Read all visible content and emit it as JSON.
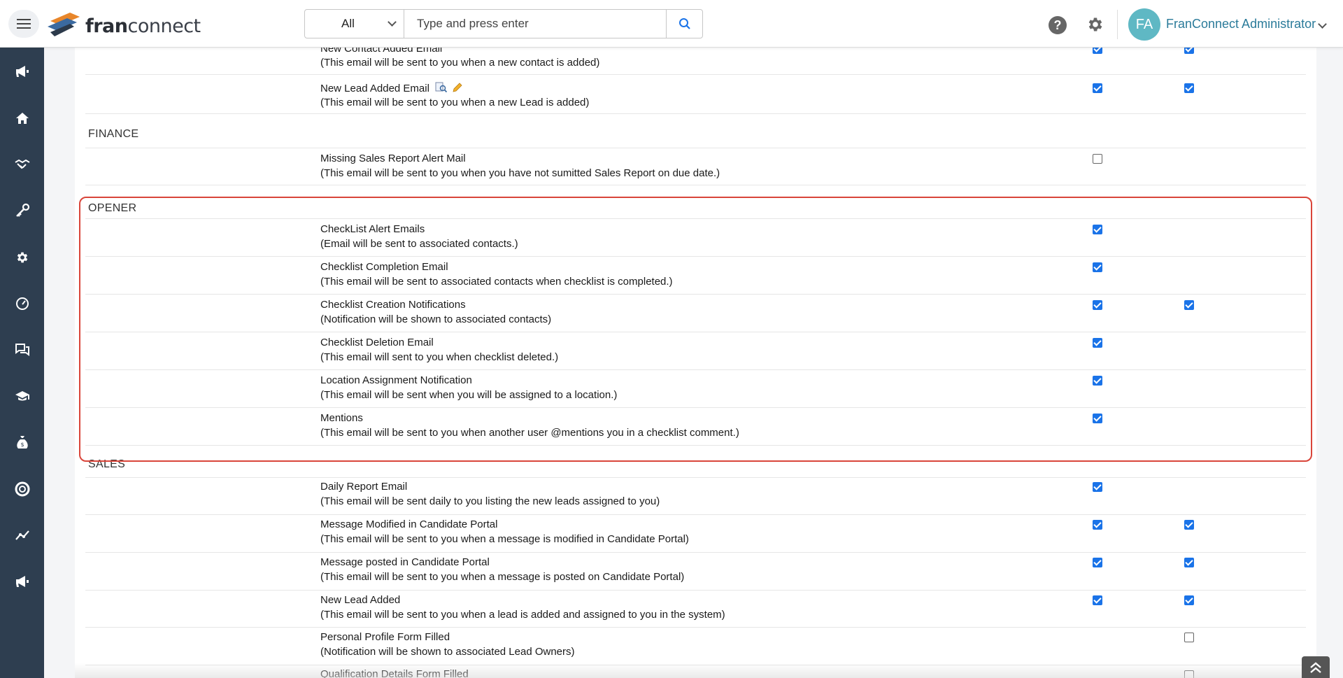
{
  "header": {
    "logo_text_bold": "fran",
    "logo_text_rest": "connect",
    "search_scope": "All",
    "search_placeholder": "Type and press enter",
    "user_initials": "FA",
    "user_name": "FranConnect Administrator"
  },
  "sidebar": {
    "items": [
      {
        "icon": "megaphone-icon"
      },
      {
        "icon": "home-icon"
      },
      {
        "icon": "handshake-icon"
      },
      {
        "icon": "key-icon"
      },
      {
        "icon": "gear-icon"
      },
      {
        "icon": "gauge-icon"
      },
      {
        "icon": "chat-icon"
      },
      {
        "icon": "graduation-cap-icon"
      },
      {
        "icon": "money-bag-icon"
      },
      {
        "icon": "lifebuoy-icon"
      },
      {
        "icon": "analytics-icon"
      },
      {
        "icon": "megaphone-icon"
      }
    ]
  },
  "sections": {
    "finance": "FINANCE",
    "opener": "OPENER",
    "sales": "SALES"
  },
  "rows": [
    {
      "title": "New Contact Added Email",
      "desc": "(This email will be sent to you when a new contact is added)",
      "col1": true,
      "col2": true
    },
    {
      "title": "New Lead Added Email",
      "desc": "(This email will be sent to you when a new Lead is added)",
      "col1": true,
      "col2": true
    },
    {
      "title": "Missing Sales Report Alert Mail",
      "desc": "(This email will be sent to you when you have not sumitted Sales Report on due date.)",
      "col1": false,
      "col2": null
    },
    {
      "title": "CheckList Alert Emails",
      "desc": "(Email will be sent to associated contacts.)",
      "col1": true,
      "col2": null
    },
    {
      "title": "Checklist Completion Email",
      "desc": "(This email will be sent to associated contacts when checklist is completed.)",
      "col1": true,
      "col2": null
    },
    {
      "title": "Checklist Creation Notifications",
      "desc": "(Notification will be shown to associated contacts)",
      "col1": true,
      "col2": true
    },
    {
      "title": "Checklist Deletion Email",
      "desc": "(This email will sent to you when checklist deleted.)",
      "col1": true,
      "col2": null
    },
    {
      "title": "Location Assignment Notification",
      "desc": "(This email will be sent when you will be assigned to a location.)",
      "col1": true,
      "col2": null
    },
    {
      "title": "Mentions",
      "desc": "(This email will be sent to you when another user @mentions you in a checklist comment.)",
      "col1": true,
      "col2": null
    },
    {
      "title": "Daily Report Email",
      "desc": "(This email will be sent daily to you listing the new leads assigned to you)",
      "col1": true,
      "col2": null
    },
    {
      "title": "Message Modified in Candidate Portal",
      "desc": "(This email will be sent to you when a message is modified in Candidate Portal)",
      "col1": true,
      "col2": true
    },
    {
      "title": "Message posted in Candidate Portal",
      "desc": "(This email will be sent to you when a message is posted on Candidate Portal)",
      "col1": true,
      "col2": true
    },
    {
      "title": "New Lead Added",
      "desc": "(This email will be sent to you when a lead is added and assigned to you in the system)",
      "col1": true,
      "col2": true
    },
    {
      "title": "Personal Profile Form Filled",
      "desc": "(Notification will be shown to associated Lead Owners)",
      "col1": null,
      "col2": false
    },
    {
      "title": "Qualification Details Form Filled",
      "desc": "",
      "col1": null,
      "col2": false
    }
  ]
}
